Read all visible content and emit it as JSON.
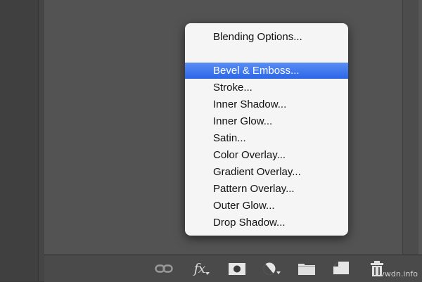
{
  "menu": {
    "items": [
      {
        "label": "Blending Options...",
        "selected": false
      },
      {
        "label": "Bevel & Emboss...",
        "selected": true
      },
      {
        "label": "Stroke...",
        "selected": false
      },
      {
        "label": "Inner Shadow...",
        "selected": false
      },
      {
        "label": "Inner Glow...",
        "selected": false
      },
      {
        "label": "Satin...",
        "selected": false
      },
      {
        "label": "Color Overlay...",
        "selected": false
      },
      {
        "label": "Gradient Overlay...",
        "selected": false
      },
      {
        "label": "Pattern Overlay...",
        "selected": false
      },
      {
        "label": "Outer Glow...",
        "selected": false
      },
      {
        "label": "Drop Shadow...",
        "selected": false
      }
    ]
  },
  "toolbar": {
    "fx_label": "fx",
    "icons": [
      "link-layers-icon",
      "fx-icon",
      "layer-mask-icon",
      "adjustment-layer-icon",
      "new-group-icon",
      "new-layer-icon",
      "trash-icon"
    ]
  },
  "watermark": "vwdn.info",
  "colors": {
    "highlight": "#3a74ee",
    "menu_bg": "#f5f5f5",
    "panel_bg": "#535353"
  }
}
